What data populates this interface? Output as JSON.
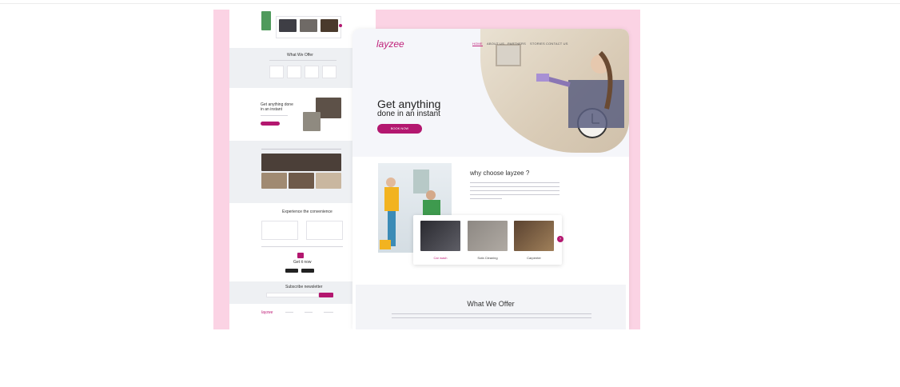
{
  "card": {
    "background": "#fbd3e4"
  },
  "brand": {
    "logo": "layzee",
    "accent": "#b3176f"
  },
  "nav": {
    "items": [
      "HOME",
      "ABOUT US",
      "PARTNERS",
      "STORIES",
      "CONTACT US"
    ],
    "active": "HOME"
  },
  "hero": {
    "headline_line1": "Get anything",
    "headline_line2": "done in an instant",
    "cta": "BOOK NOW"
  },
  "why": {
    "title": "why choose layzee ?"
  },
  "services": [
    {
      "label": "Car wash"
    },
    {
      "label": "Sofa Cleaning"
    },
    {
      "label": "Carpenter"
    }
  ],
  "offer": {
    "title": "What We Offer"
  },
  "long_page": {
    "offer_title": "What We Offer",
    "get_anything_line1": "Get anything done",
    "get_anything_line2": "in an instant",
    "experience_title": "Experience the convenience",
    "get_it_now": "Get it now",
    "newsletter_title": "Subscribe newsletter",
    "footer_logo": "layzee"
  }
}
